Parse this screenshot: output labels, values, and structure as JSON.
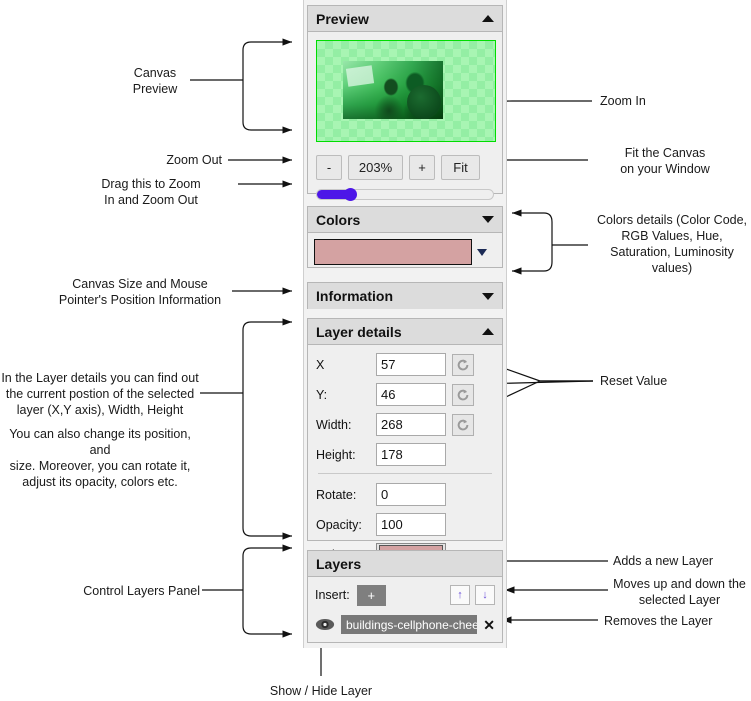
{
  "panels": {
    "preview": {
      "title": "Preview",
      "collapse_icon": "triangle-up-icon",
      "zoom_out_label": "-",
      "zoom_level": "203%",
      "zoom_in_label": "+",
      "fit_label": "Fit"
    },
    "colors": {
      "title": "Colors",
      "collapse_icon": "triangle-down-icon",
      "swatch_color": "#d4a2a2"
    },
    "information": {
      "title": "Information",
      "collapse_icon": "triangle-down-icon"
    },
    "layer_details": {
      "title": "Layer details",
      "collapse_icon": "triangle-up-icon",
      "fields": [
        {
          "label": "X",
          "value": "57",
          "reset": true
        },
        {
          "label": "Y:",
          "value": "46",
          "reset": true
        },
        {
          "label": "Width:",
          "value": "268",
          "reset": true
        },
        {
          "label": "Height:",
          "value": "178",
          "reset": false
        }
      ],
      "fields2": [
        {
          "label": "Rotate:",
          "value": "0"
        },
        {
          "label": "Opacity:",
          "value": "100"
        }
      ],
      "color_label": "Color:",
      "color_value": "#d4a2a2"
    },
    "layers": {
      "title": "Layers",
      "insert_label": "Insert:",
      "add_label": "+",
      "move_up_label": "↑",
      "move_down_label": "↓",
      "layer_name": "buildings-cellphone-cheerful",
      "remove_label": "✕",
      "visibility_icon": "eye-icon"
    }
  },
  "annotations": {
    "canvas_preview": "Canvas\nPreview",
    "zoom_out": "Zoom Out",
    "drag_zoom": "Drag this to Zoom\nIn and Zoom Out",
    "canvas_size_info": "Canvas Size and Mouse\nPointer's Position Information",
    "layer_details_info": "In the Layer details you can find out\nthe current postion of the selected\nlayer (X,Y axis), Width, Height",
    "layer_details_info2": "You can also change its position, and\nsize. Moreover, you can rotate it,\nadjust its opacity, colors etc.",
    "control_layers": "Control Layers Panel",
    "show_hide_layer": "Show / Hide Layer",
    "zoom_in": "Zoom In",
    "fit_canvas": "Fit the Canvas\non your Window",
    "colors_details": "Colors details (Color Code,\nRGB Values, Hue,\nSaturation, Luminosity\nvalues)",
    "reset_value": "Reset Value",
    "adds_layer": "Adds a new Layer",
    "moves_layer": "Moves up and down the\nselected Layer",
    "removes_layer": "Removes the Layer"
  }
}
